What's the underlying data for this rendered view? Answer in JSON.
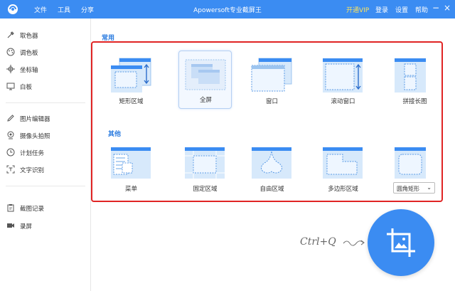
{
  "titlebar": {
    "menu": [
      "文件",
      "工具",
      "分享"
    ],
    "title": "Apowersoft专业截屏王",
    "vip": "开通VIP",
    "login": "登录",
    "settings": "设置",
    "help": "帮助",
    "minimize": "−",
    "close": "×",
    "bg_color": "#3b8cf2"
  },
  "sidebar": {
    "group1": [
      "取色器",
      "调色板",
      "坐标轴",
      "白板"
    ],
    "group2": [
      "图片编辑器",
      "摄像头拍照",
      "计划任务",
      "文字识别"
    ],
    "group3": [
      "截图记录",
      "录屏"
    ]
  },
  "sections": {
    "common": "常用",
    "other": "其他"
  },
  "common_modes": [
    "矩形区域",
    "全屏",
    "窗口",
    "滚动窗口",
    "拼接长图"
  ],
  "other_modes": [
    "菜单",
    "固定区域",
    "自由区域",
    "多边形区域"
  ],
  "shape_select": {
    "value": "圆角矩形"
  },
  "hotkey": "Ctrl+Q",
  "accent_color": "#3b8cf2",
  "highlight_color": "#e02424"
}
